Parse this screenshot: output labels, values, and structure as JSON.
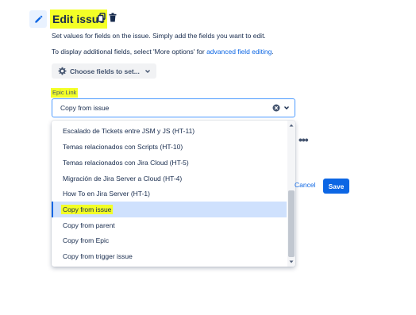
{
  "header": {
    "title": "Edit issue",
    "pencil_icon": "pencil-icon",
    "copy_icon": "copy-icon",
    "trash_icon": "trash-icon"
  },
  "description": {
    "line1": "Set values for fields on the issue. Simply add the fields you want to edit.",
    "line2_prefix": "To display additional fields, select 'More options' for ",
    "line2_link": "advanced field editing",
    "line2_suffix": "."
  },
  "choose_fields": {
    "label": "Choose fields to set...",
    "icon": "gear-icon"
  },
  "field": {
    "label": "Epic Link",
    "value": "Copy from issue"
  },
  "dropdown": {
    "options": [
      {
        "label": "Escalado de Tickets entre JSM y JS (HT-11)",
        "selected": false
      },
      {
        "label": "Temas relacionados con Scripts (HT-10)",
        "selected": false
      },
      {
        "label": "Temas relacionados con Jira Cloud (HT-5)",
        "selected": false
      },
      {
        "label": "Migración de Jira Server a Cloud (HT-4)",
        "selected": false
      },
      {
        "label": "How To en Jira Server (HT-1)",
        "selected": false
      },
      {
        "label": "Copy from issue",
        "selected": true
      },
      {
        "label": "Copy from parent",
        "selected": false
      },
      {
        "label": "Copy from Epic",
        "selected": false
      },
      {
        "label": "Copy from trigger issue",
        "selected": false
      }
    ]
  },
  "actions": {
    "more": "•••",
    "cancel": "Cancel",
    "save": "Save"
  },
  "colors": {
    "highlight": "#f3ff26",
    "accent": "#0c66e4",
    "selected_bg": "#cfe1fd"
  }
}
